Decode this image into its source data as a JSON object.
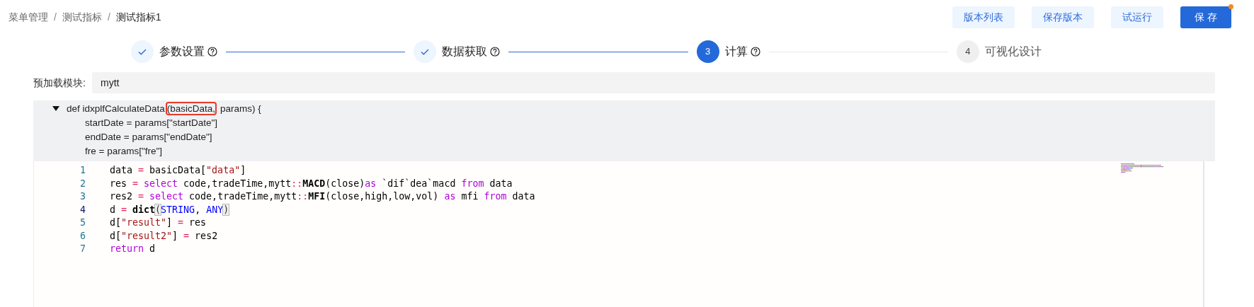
{
  "breadcrumb": [
    {
      "label": "菜单管理",
      "current": false
    },
    {
      "label": "测试指标",
      "current": false
    },
    {
      "label": "测试指标1",
      "current": true
    }
  ],
  "breadcrumb_separator": "/",
  "actions": [
    {
      "label": "版本列表",
      "kind": "light"
    },
    {
      "label": "保存版本",
      "kind": "light"
    },
    {
      "label": "试运行",
      "kind": "light"
    },
    {
      "label": "保 存",
      "kind": "primary",
      "dot": true
    }
  ],
  "steps": [
    {
      "label": "参数设置",
      "completed": true,
      "selected": false,
      "help": true
    },
    {
      "label": "数据获取",
      "completed": true,
      "selected": false,
      "help": true
    },
    {
      "label": "计算",
      "completed": false,
      "selected": true,
      "number": "3",
      "help": true
    },
    {
      "label": "可视化设计",
      "completed": false,
      "selected": false,
      "number": "4",
      "help": false
    }
  ],
  "preload": {
    "label": "预加载模块:",
    "value": "mytt"
  },
  "signature": {
    "expanded": true,
    "parts": [
      {
        "text": "def idxplfCalculateData",
        "highlighted": false
      },
      {
        "text": "(basicData,",
        "highlighted": true
      },
      {
        "text": " params) {",
        "highlighted": false
      }
    ],
    "lines": [
      "startDate = params[\"startDate\"]",
      "endDate = params[\"endDate\"]",
      "fre = params[\"fre\"]"
    ]
  },
  "code": [
    {
      "number": "1",
      "active": false,
      "tokens": [
        {
          "text": "data ",
          "kind": "plain"
        },
        {
          "text": "=",
          "kind": "op"
        },
        {
          "text": " basicData[",
          "kind": "plain"
        },
        {
          "text": "\"data\"",
          "kind": "string"
        },
        {
          "text": "]",
          "kind": "plain"
        }
      ]
    },
    {
      "number": "2",
      "active": false,
      "tokens": [
        {
          "text": "res ",
          "kind": "plain"
        },
        {
          "text": "=",
          "kind": "op"
        },
        {
          "text": " select",
          "kind": "keyword"
        },
        {
          "text": " code,tradeTime,mytt",
          "kind": "plain"
        },
        {
          "text": "::",
          "kind": "op"
        },
        {
          "text": "MACD",
          "kind": "func"
        },
        {
          "text": "(close)",
          "kind": "plain"
        },
        {
          "text": "as",
          "kind": "keyword"
        },
        {
          "text": " `dif`dea`macd ",
          "kind": "plain"
        },
        {
          "text": "from",
          "kind": "keyword"
        },
        {
          "text": " data",
          "kind": "plain"
        }
      ]
    },
    {
      "number": "3",
      "active": false,
      "tokens": [
        {
          "text": "res2 ",
          "kind": "plain"
        },
        {
          "text": "=",
          "kind": "op"
        },
        {
          "text": " select",
          "kind": "keyword"
        },
        {
          "text": " code,tradeTime,mytt",
          "kind": "plain"
        },
        {
          "text": "::",
          "kind": "op"
        },
        {
          "text": "MFI",
          "kind": "func"
        },
        {
          "text": "(close,high,low,vol) ",
          "kind": "plain"
        },
        {
          "text": "as",
          "kind": "keyword"
        },
        {
          "text": " mfi ",
          "kind": "plain"
        },
        {
          "text": "from",
          "kind": "keyword"
        },
        {
          "text": " data",
          "kind": "plain"
        }
      ]
    },
    {
      "number": "4",
      "active": true,
      "tokens": [
        {
          "text": "d ",
          "kind": "plain"
        },
        {
          "text": "=",
          "kind": "op"
        },
        {
          "text": " dict",
          "kind": "func"
        },
        {
          "text": "(",
          "kind": "bracket"
        },
        {
          "text": "STRING",
          "kind": "type"
        },
        {
          "text": ", ",
          "kind": "plain"
        },
        {
          "text": "ANY",
          "kind": "type"
        },
        {
          "text": ")",
          "kind": "bracket"
        }
      ]
    },
    {
      "number": "5",
      "active": false,
      "tokens": [
        {
          "text": "d[",
          "kind": "plain"
        },
        {
          "text": "\"result\"",
          "kind": "string"
        },
        {
          "text": "] ",
          "kind": "plain"
        },
        {
          "text": "=",
          "kind": "op"
        },
        {
          "text": " res",
          "kind": "plain"
        }
      ]
    },
    {
      "number": "6",
      "active": false,
      "tokens": [
        {
          "text": "d[",
          "kind": "plain"
        },
        {
          "text": "\"result2\"",
          "kind": "string"
        },
        {
          "text": "] ",
          "kind": "plain"
        },
        {
          "text": "=",
          "kind": "op"
        },
        {
          "text": " res2",
          "kind": "plain"
        }
      ]
    },
    {
      "number": "7",
      "active": false,
      "tokens": [
        {
          "text": "return",
          "kind": "keyword"
        },
        {
          "text": " d",
          "kind": "plain"
        }
      ]
    }
  ]
}
